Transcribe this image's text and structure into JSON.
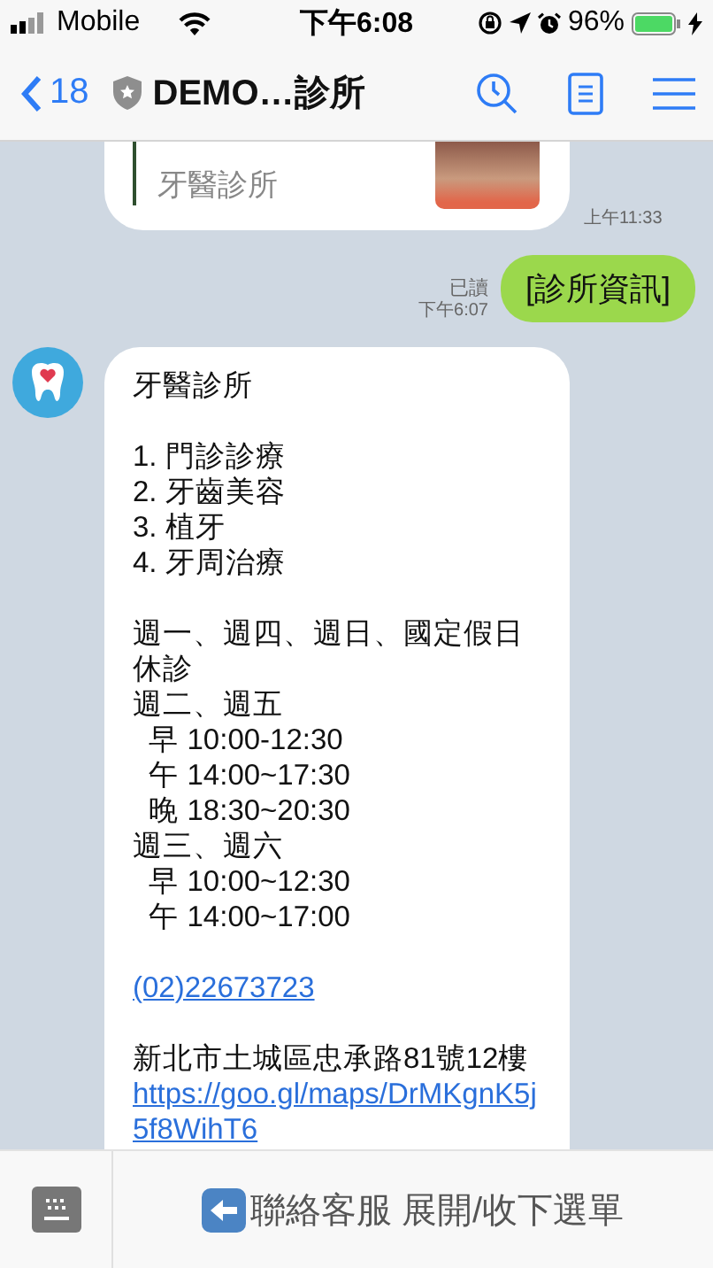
{
  "status_bar": {
    "carrier": "Mobile",
    "time": "下午6:08",
    "battery": "96%"
  },
  "header": {
    "back_count": "18",
    "title": "DEMO…診所"
  },
  "messages": [
    {
      "kind": "card",
      "subtitle": "牙醫診所",
      "time": "上午11:33"
    },
    {
      "kind": "sent",
      "text": "[診所資訊]",
      "read": "已讀",
      "time": "下午6:07"
    },
    {
      "kind": "received",
      "blocks": [
        {
          "lines": [
            {
              "kind": "text",
              "text": "牙醫診所"
            }
          ]
        },
        {
          "lines": [
            {
              "kind": "text",
              "text": "1. 門診診療"
            },
            {
              "kind": "text",
              "text": "2. 牙齒美容"
            },
            {
              "kind": "text",
              "text": "3. 植牙"
            },
            {
              "kind": "text",
              "text": "4. 牙周治療"
            }
          ]
        },
        {
          "lines": [
            {
              "kind": "text",
              "text": "週一、週四、週日、國定假日休診"
            },
            {
              "kind": "text",
              "text": "週二、週五"
            },
            {
              "kind": "text",
              "text": "  早 10:00-12:30"
            },
            {
              "kind": "text",
              "text": "  午 14:00~17:30"
            },
            {
              "kind": "text",
              "text": "  晚 18:30~20:30"
            },
            {
              "kind": "text",
              "text": "週三、週六"
            },
            {
              "kind": "text",
              "text": "  早 10:00~12:30"
            },
            {
              "kind": "text",
              "text": "  午 14:00~17:00"
            }
          ]
        },
        {
          "lines": [
            {
              "kind": "link",
              "text": "(02)22673723"
            }
          ]
        },
        {
          "lines": [
            {
              "kind": "text",
              "text": "新北市土城區忠承路81號12樓"
            },
            {
              "kind": "link",
              "text": "https://goo.gl/maps/DrMKgnK5j5f8WihT6"
            }
          ]
        }
      ]
    }
  ],
  "bottom_bar": {
    "label": "聯絡客服 展開/收下選單"
  }
}
